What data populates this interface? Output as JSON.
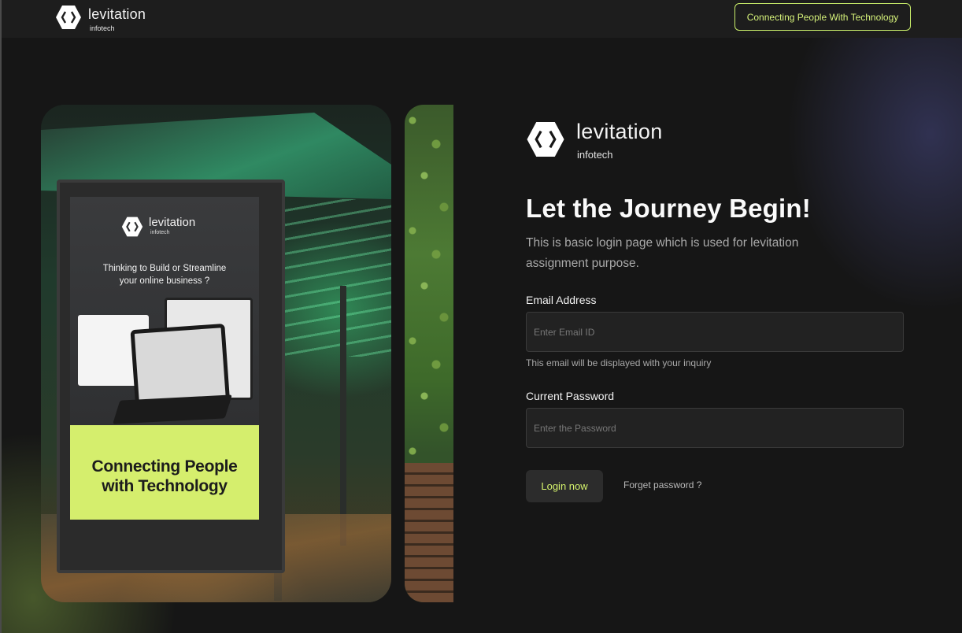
{
  "topbar": {
    "brand_name": "levitation",
    "brand_sub": "infotech",
    "tagline_button": "Connecting People With Technology"
  },
  "poster": {
    "brand_name": "levitation",
    "brand_sub": "infotech",
    "question_line1": "Thinking to Build or Streamline",
    "question_line2": "your online business ?",
    "slogan_line1": "Connecting People",
    "slogan_line2": "with Technology"
  },
  "login": {
    "brand_name": "levitation",
    "brand_sub": "infotech",
    "headline": "Let the Journey Begin!",
    "subtext": "This is basic login page which is used for levitation assignment purpose.",
    "email_label": "Email Address",
    "email_placeholder": "Enter Email ID",
    "email_value": "",
    "email_hint": "This email will be displayed with your inquiry",
    "password_label": "Current Password",
    "password_placeholder": "Enter the Password",
    "password_value": "",
    "login_button": "Login now",
    "forgot_link": "Forget password ?"
  },
  "icons": {
    "logo": "hexagon-code-brackets-icon"
  },
  "colors": {
    "accent": "#d4f26c",
    "background": "#161616",
    "input_bg": "#222222"
  }
}
